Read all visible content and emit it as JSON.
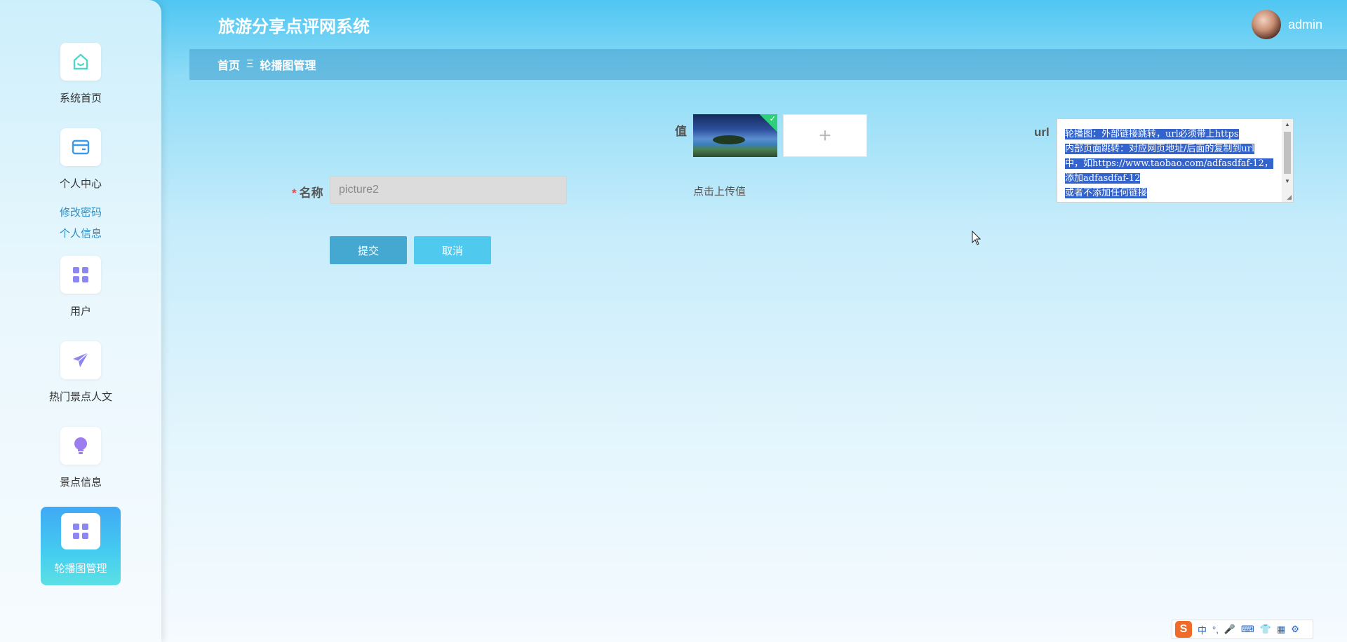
{
  "header": {
    "app_title": "旅游分享点评网系统",
    "username": "admin"
  },
  "breadcrumb": {
    "home": "首页",
    "separator": "Ξ",
    "current": "轮播图管理"
  },
  "sidebar": {
    "items": [
      {
        "label": "系统首页",
        "icon": "home-icon"
      },
      {
        "label": "个人中心",
        "icon": "wallet-icon"
      },
      {
        "label": "用户",
        "icon": "grid-icon"
      },
      {
        "label": "热门景点人文",
        "icon": "paper-plane-icon"
      },
      {
        "label": "景点信息",
        "icon": "lightbulb-icon"
      },
      {
        "label": "轮播图管理",
        "icon": "grid-icon",
        "active": true
      }
    ],
    "submenu": [
      "修改密码",
      "个人信息"
    ]
  },
  "form": {
    "name_label": "名称",
    "required_mark": "*",
    "name_value": "picture2",
    "value_label": "值",
    "upload_plus": "+",
    "upload_tip": "点击上传值",
    "url_label": "url",
    "url_lines": [
      "轮播图：外部链接跳转，url必须带上https",
      "内部页面跳转：对应网页地址/后面的复制到url",
      "中，如https://www.taobao.com/adfasdfaf-12，",
      "添加adfasdfaf-12",
      "或者不添加任何链接"
    ],
    "submit_label": "提交",
    "cancel_label": "取消"
  },
  "ime": {
    "logo": "S",
    "items": [
      "中",
      "°,",
      "🎤",
      "⌨",
      "👕",
      "▦",
      "⚙"
    ]
  },
  "colors": {
    "accent": "#45a8d0",
    "active_menu": "#3fa9f5",
    "selection": "#3363cd",
    "required": "#e84b4b"
  }
}
